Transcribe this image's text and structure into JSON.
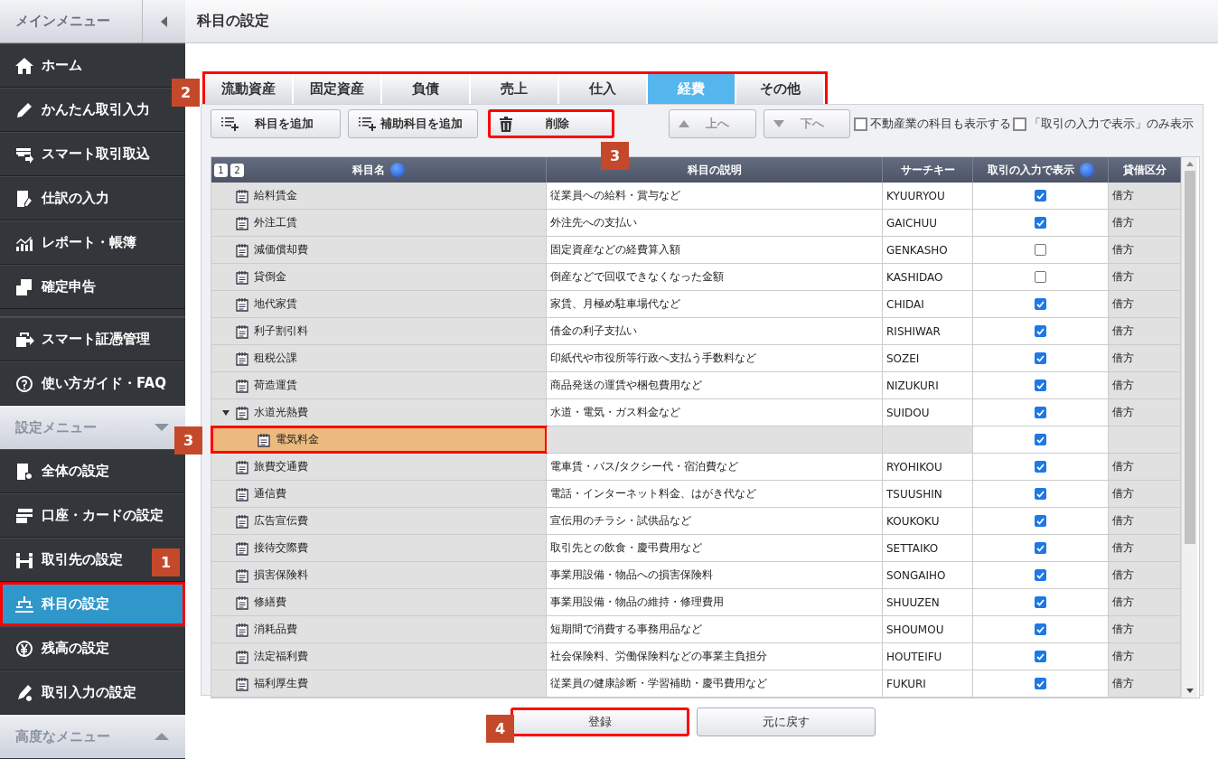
{
  "sidebar": {
    "title": "メインメニュー",
    "groups": [
      {
        "items": [
          {
            "label": "ホーム",
            "selected": false
          },
          {
            "label": "かんたん取引入力",
            "selected": false
          },
          {
            "label": "スマート取引取込",
            "selected": false
          },
          {
            "label": "仕訳の入力",
            "selected": false
          },
          {
            "label": "レポート・帳簿",
            "selected": false
          },
          {
            "label": "確定申告",
            "selected": false
          }
        ]
      },
      {
        "items": [
          {
            "label": "スマート証憑管理",
            "selected": false
          },
          {
            "label": "使い方ガイド・FAQ",
            "selected": false
          }
        ]
      },
      {
        "header": "設定メニュー",
        "expanded": true,
        "items": [
          {
            "label": "全体の設定",
            "selected": false,
            "highlighted": false
          },
          {
            "label": "口座・カードの設定",
            "selected": false,
            "highlighted": false
          },
          {
            "label": "取引先の設定",
            "selected": false,
            "highlighted": false
          },
          {
            "label": "科目の設定",
            "selected": true,
            "highlighted": true
          },
          {
            "label": "残高の設定",
            "selected": false,
            "highlighted": false
          },
          {
            "label": "取引入力の設定",
            "selected": false,
            "highlighted": false
          }
        ]
      },
      {
        "header": "高度なメニュー",
        "expanded": false
      }
    ]
  },
  "page_title": "科目の設定",
  "tabs": [
    {
      "label": "流動資産",
      "selected": false
    },
    {
      "label": "固定資産",
      "selected": false
    },
    {
      "label": "負債",
      "selected": false
    },
    {
      "label": "売上",
      "selected": false
    },
    {
      "label": "仕入",
      "selected": false
    },
    {
      "label": "経費",
      "selected": true
    },
    {
      "label": "その他",
      "selected": false
    }
  ],
  "toolbar": {
    "buttons": [
      {
        "label": "科目を追加",
        "kind": "add",
        "disabled": false,
        "highlighted": false
      },
      {
        "label": "補助科目を追加",
        "kind": "add",
        "disabled": false,
        "highlighted": false
      },
      {
        "label": "削除",
        "kind": "delete",
        "disabled": false,
        "highlighted": true
      },
      {
        "label": "上へ",
        "kind": "up",
        "disabled": true,
        "highlighted": false
      },
      {
        "label": "下へ",
        "kind": "down",
        "disabled": true,
        "highlighted": false
      }
    ],
    "checkboxes": [
      {
        "label": "不動産業の科目も表示する",
        "checked": false
      },
      {
        "label": "「取引の入力で表示」のみ表示",
        "checked": false
      }
    ]
  },
  "table": {
    "level_buttons": [
      "1",
      "2"
    ],
    "columns": [
      "科目名",
      "科目の説明",
      "サーチキー",
      "取引の入力で表示",
      "貸借区分"
    ],
    "rows": [
      {
        "name": "給料賃金",
        "description": "従業員への給料・賞与など",
        "key": "KYUURYOU",
        "shown": true,
        "side": "借方"
      },
      {
        "name": "外注工賃",
        "description": "外注先への支払い",
        "key": "GAICHUU",
        "shown": true,
        "side": "借方"
      },
      {
        "name": "減価償却費",
        "description": "固定資産などの経費算入額",
        "key": "GENKASHO",
        "shown": false,
        "side": "借方"
      },
      {
        "name": "貸倒金",
        "description": "倒産などで回収できなくなった金額",
        "key": "KASHIDAO",
        "shown": false,
        "side": "借方"
      },
      {
        "name": "地代家賃",
        "description": "家賃、月極め駐車場代など",
        "key": "CHIDAI",
        "shown": true,
        "side": "借方"
      },
      {
        "name": "利子割引料",
        "description": "借金の利子支払い",
        "key": "RISHIWAR",
        "shown": true,
        "side": "借方"
      },
      {
        "name": "租税公課",
        "description": "印紙代や市役所等行政へ支払う手数料など",
        "key": "SOZEI",
        "shown": true,
        "side": "借方"
      },
      {
        "name": "荷造運賃",
        "description": "商品発送の運賃や梱包費用など",
        "key": "NIZUKURI",
        "shown": true,
        "side": "借方"
      },
      {
        "name": "水道光熱費",
        "description": "水道・電気・ガス料金など",
        "key": "SUIDOU",
        "shown": true,
        "side": "借方",
        "expanded": true,
        "children": [
          {
            "name": "電気料金",
            "shown": true,
            "selected": true,
            "highlighted": true
          }
        ]
      },
      {
        "name": "旅費交通費",
        "description": "電車賃・バス/タクシー代・宿泊費など",
        "key": "RYOHIKOU",
        "shown": true,
        "side": "借方"
      },
      {
        "name": "通信費",
        "description": "電話・インターネット料金、はがき代など",
        "key": "TSUUSHIN",
        "shown": true,
        "side": "借方"
      },
      {
        "name": "広告宣伝費",
        "description": "宣伝用のチラシ・試供品など",
        "key": "KOUKOKU",
        "shown": true,
        "side": "借方"
      },
      {
        "name": "接待交際費",
        "description": "取引先との飲食・慶弔費用など",
        "key": "SETTAIKO",
        "shown": true,
        "side": "借方"
      },
      {
        "name": "損害保険料",
        "description": "事業用設備・物品への損害保険料",
        "key": "SONGAIHO",
        "shown": true,
        "side": "借方"
      },
      {
        "name": "修繕費",
        "description": "事業用設備・物品の維持・修理費用",
        "key": "SHUUZEN",
        "shown": true,
        "side": "借方"
      },
      {
        "name": "消耗品費",
        "description": "短期間で消費する事務用品など",
        "key": "SHOUMOU",
        "shown": true,
        "side": "借方"
      },
      {
        "name": "法定福利費",
        "description": "社会保険料、労働保険料などの事業主負担分",
        "key": "HOUTEIFU",
        "shown": true,
        "side": "借方"
      },
      {
        "name": "福利厚生費",
        "description": "従業員の健康診断・学習補助・慶弔費用など",
        "key": "FUKURI",
        "shown": true,
        "side": "借方"
      }
    ]
  },
  "footer_buttons": [
    {
      "label": "登録",
      "highlighted": true
    },
    {
      "label": "元に戻す",
      "highlighted": false
    }
  ],
  "callouts": [
    "1",
    "2",
    "3",
    "3",
    "4"
  ]
}
